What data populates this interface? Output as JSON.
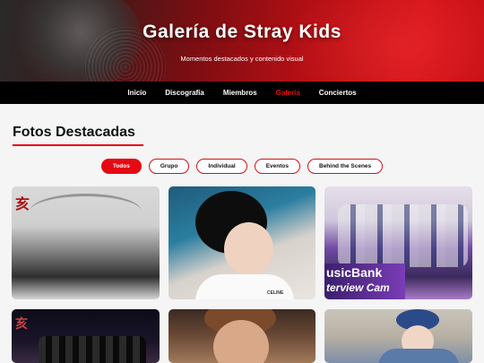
{
  "header": {
    "title": "Galería de Stray Kids",
    "subtitle": "Momentos destacados y contenido visual"
  },
  "nav": {
    "items": [
      {
        "label": "Inicio",
        "active": false
      },
      {
        "label": "Discografía",
        "active": false
      },
      {
        "label": "Miembros",
        "active": false
      },
      {
        "label": "Galería",
        "active": true
      },
      {
        "label": "Conciertos",
        "active": false
      }
    ]
  },
  "gallery": {
    "title": "Fotos Destacadas",
    "filters": [
      {
        "label": "Todos",
        "active": true
      },
      {
        "label": "Grupo",
        "active": false
      },
      {
        "label": "Individual",
        "active": false
      },
      {
        "label": "Eventos",
        "active": false
      },
      {
        "label": "Behind the Scenes",
        "active": false
      }
    ],
    "photos": [
      {
        "name": "group-photo-traditional"
      },
      {
        "name": "individual-portrait"
      },
      {
        "name": "music-bank-interview",
        "overlay_line1": "usicBank",
        "overlay_line2": "terview Cam"
      },
      {
        "name": "group-stage-photo"
      },
      {
        "name": "individual-closeup"
      },
      {
        "name": "event-outdoor-photo"
      }
    ]
  },
  "colors": {
    "accent": "#e50914",
    "nav_bg": "#000000",
    "page_bg": "#f5f5f5"
  }
}
